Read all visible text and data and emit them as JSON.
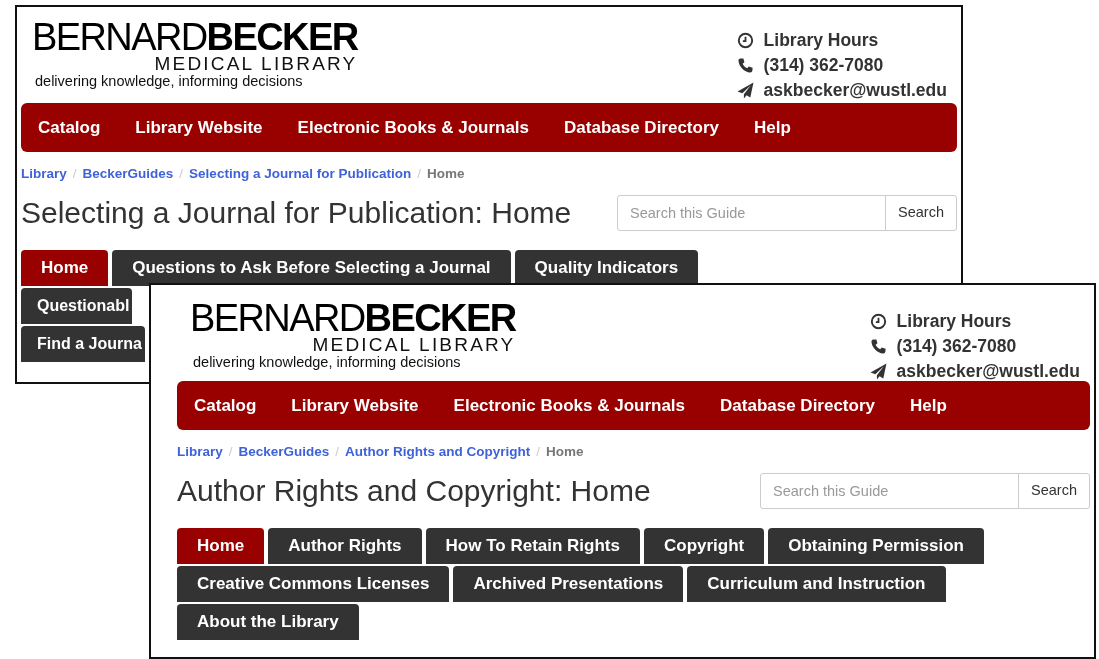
{
  "windows": [
    {
      "logo": {
        "wordmark": "BERNARD**BECKER**",
        "subtitle": "MEDICAL LIBRARY",
        "tagline": "delivering knowledge, informing decisions"
      },
      "contact": [
        {
          "kind": "hours",
          "text": "Library Hours"
        },
        {
          "kind": "phone",
          "text": "(314) 362-7080"
        },
        {
          "kind": "email",
          "text": "askbecker@wustl.edu"
        }
      ],
      "nav": [
        "Catalog",
        "Library Website",
        "Electronic Books & Journals",
        "Database Directory",
        "Help"
      ],
      "breadcrumb": [
        {
          "text": "Library",
          "current": false
        },
        {
          "separator": "/",
          "text": "BeckerGuides",
          "current": false
        },
        {
          "separator": "/",
          "text": "Selecting a Journal for Publication",
          "current": false
        },
        {
          "separator": "/",
          "text": "Home",
          "current": true
        }
      ],
      "title": "Selecting a Journal for Publication: Home",
      "search": {
        "placeholder": "Search this Guide",
        "button": "Search"
      },
      "tab_rows": [
        [
          {
            "label": "Home",
            "selected": true
          },
          {
            "label": "Questions to Ask Before Selecting a Journal",
            "selected": false
          },
          {
            "label": "Quality Indicators",
            "selected": false
          }
        ],
        [
          {
            "label": "Questionabl",
            "selected": false
          }
        ],
        [
          {
            "label": "Find a Journa",
            "selected": false
          }
        ]
      ]
    },
    {
      "logo": {
        "wordmark": "BERNARD**BECKER**",
        "subtitle": "MEDICAL LIBRARY",
        "tagline": "delivering knowledge, informing decisions"
      },
      "contact": [
        {
          "kind": "hours",
          "text": "Library Hours"
        },
        {
          "kind": "phone",
          "text": "(314) 362-7080"
        },
        {
          "kind": "email",
          "text": "askbecker@wustl.edu"
        }
      ],
      "nav": [
        "Catalog",
        "Library Website",
        "Electronic Books & Journals",
        "Database Directory",
        "Help"
      ],
      "breadcrumb": [
        {
          "text": "Library",
          "current": false
        },
        {
          "separator": "/",
          "text": "BeckerGuides",
          "current": false
        },
        {
          "separator": "/",
          "text": "Author Rights and Copyright",
          "current": false
        },
        {
          "separator": "/",
          "text": "Home",
          "current": true
        }
      ],
      "title": "Author Rights and Copyright: Home",
      "search": {
        "placeholder": "Search this Guide",
        "button": "Search"
      },
      "tab_rows": [
        [
          {
            "label": "Home",
            "selected": true
          },
          {
            "label": "Author Rights",
            "selected": false
          },
          {
            "label": "How To Retain Rights",
            "selected": false
          },
          {
            "label": "Copyright",
            "selected": false
          },
          {
            "label": "Obtaining Permission",
            "selected": false
          }
        ],
        [
          {
            "label": "Creative Commons Licenses",
            "selected": false
          },
          {
            "label": "Archived Presentations",
            "selected": false
          },
          {
            "label": "Curriculum and Instruction",
            "selected": false
          }
        ],
        [
          {
            "label": "About the Library",
            "selected": false
          }
        ]
      ]
    }
  ]
}
